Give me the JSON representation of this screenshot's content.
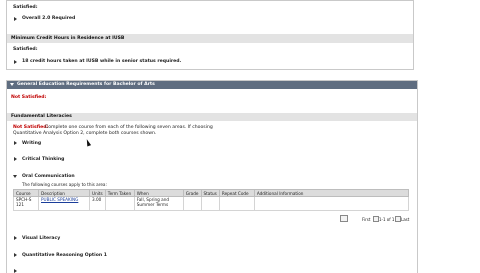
{
  "top_block": {
    "satisfied_1": "Satisfied:",
    "overall_req": "Overall 2.0 Required",
    "residence_header": "Minimum Credit Hours in Residence at IUSB",
    "satisfied_2": "Satisfied:",
    "residence_req": "18 credit hours taken at IUSB while in senior status required."
  },
  "gen_ed": {
    "header": "General Education Requirements for Bachelor of Arts",
    "status": "Not Satisfied:"
  },
  "fundamental": {
    "header": "Fundamental Literacies",
    "status_label": "Not Satisfied:",
    "instructions_1": "Complete one course from each of the following seven areas. If choosing",
    "instructions_2": "Quantitative Analysis Option 2, complete both courses shown.",
    "areas": {
      "writing": "Writing",
      "critical_thinking": "Critical Thinking",
      "oral_communication": "Oral Communication",
      "visual_literacy": "Visual Literacy",
      "quant_option1": "Quantitative Reasoning Option 1"
    },
    "oral_note": "The following courses apply to this area:"
  },
  "course_table": {
    "columns": [
      "Course",
      "Description",
      "Units",
      "Term Taken",
      "When",
      "Grade",
      "Status",
      "Repeat Code",
      "Additional Information"
    ],
    "rows": [
      {
        "course": "SPCH-S 121",
        "description": "PUBLIC SPEAKING",
        "units": "3.00",
        "term": "",
        "when_1": "Fall, Spring and",
        "when_2": "Summer Terms",
        "grade": "",
        "status": "",
        "repeat": "",
        "info": ""
      }
    ],
    "nav": {
      "first": "First",
      "range": "1-1 of 1",
      "last": "Last"
    }
  }
}
